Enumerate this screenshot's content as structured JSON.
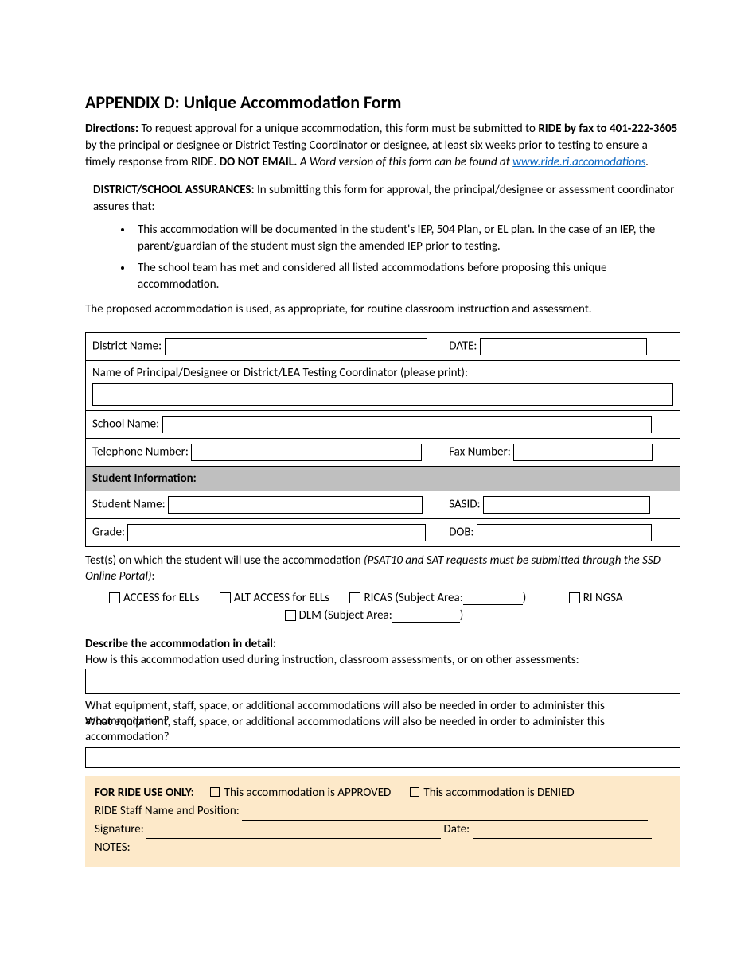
{
  "title": "APPENDIX D: Unique Accommodation Form",
  "directions": {
    "label": "Directions:",
    "part1": " To request approval for a unique accommodation, this form must be submitted to ",
    "bold1": "RIDE by fax to 401-222-3605",
    "part2": " by the principal or designee or District Testing Coordinator or designee, at least six weeks prior to testing to ensure a timely response from RIDE. ",
    "bold2": "DO NOT EMAIL.",
    "italic1": " A Word version of this form can be found at ",
    "link_text": "www.ride.ri.accomodations",
    "period": "."
  },
  "assurances": {
    "label": "DISTRICT/SCHOOL ASSURANCES:",
    "intro": " In submitting this form for approval, the principal/designee or assessment coordinator assures that:",
    "bullets": [
      "This accommodation will be documented in the student's IEP, 504 Plan, or EL plan. In the case of an IEP, the parent/guardian of the student must sign the amended IEP prior to testing.",
      "The school team has met and considered all listed accommodations before proposing this unique accommodation."
    ],
    "tail": "The proposed accommodation is used, as appropriate, for routine classroom instruction and assessment."
  },
  "form": {
    "district_name_label": "District Name:",
    "date_label": "DATE:",
    "principal_label": "Name of Principal/Designee or District/LEA Testing Coordinator (please print):",
    "school_name_label": "School Name:",
    "telephone_label": "Telephone Number:",
    "fax_label": "Fax Number:",
    "student_info_header": "Student Information:",
    "student_name_label": "Student Name:",
    "sasid_label": "SASID:",
    "grade_label": "Grade:",
    "dob_label": "DOB:"
  },
  "tests": {
    "intro": "Test(s) on which the student will use the accommodation ",
    "intro_italic": "(PSAT10 and SAT requests must be submitted through the SSD Online Portal)",
    "colon": ":",
    "access": "ACCESS for ELLs",
    "alt_access": "ALT ACCESS for ELLs",
    "ricas": "RICAS (Subject Area:",
    "ricas_close": ")",
    "ri_ngsa": "RI NGSA",
    "dlm": "DLM (Subject Area:",
    "dlm_close": ")"
  },
  "describe": {
    "heading": "Describe the accommodation in detail:",
    "q1": "How is this accommodation used during instruction, classroom assessments, or on other assessments:",
    "q2": "What equipment, staff, space, or additional accommodations will also be needed in order to administer this accommodation?"
  },
  "ride": {
    "heading": "FOR RIDE USE ONLY:",
    "approved": "This accommodation is APPROVED",
    "denied": "This accommodation is DENIED",
    "staff_label": "RIDE Staff Name and Position: ",
    "signature_label": "Signature: ",
    "date_label": " Date: ",
    "notes_label": "NOTES:"
  }
}
